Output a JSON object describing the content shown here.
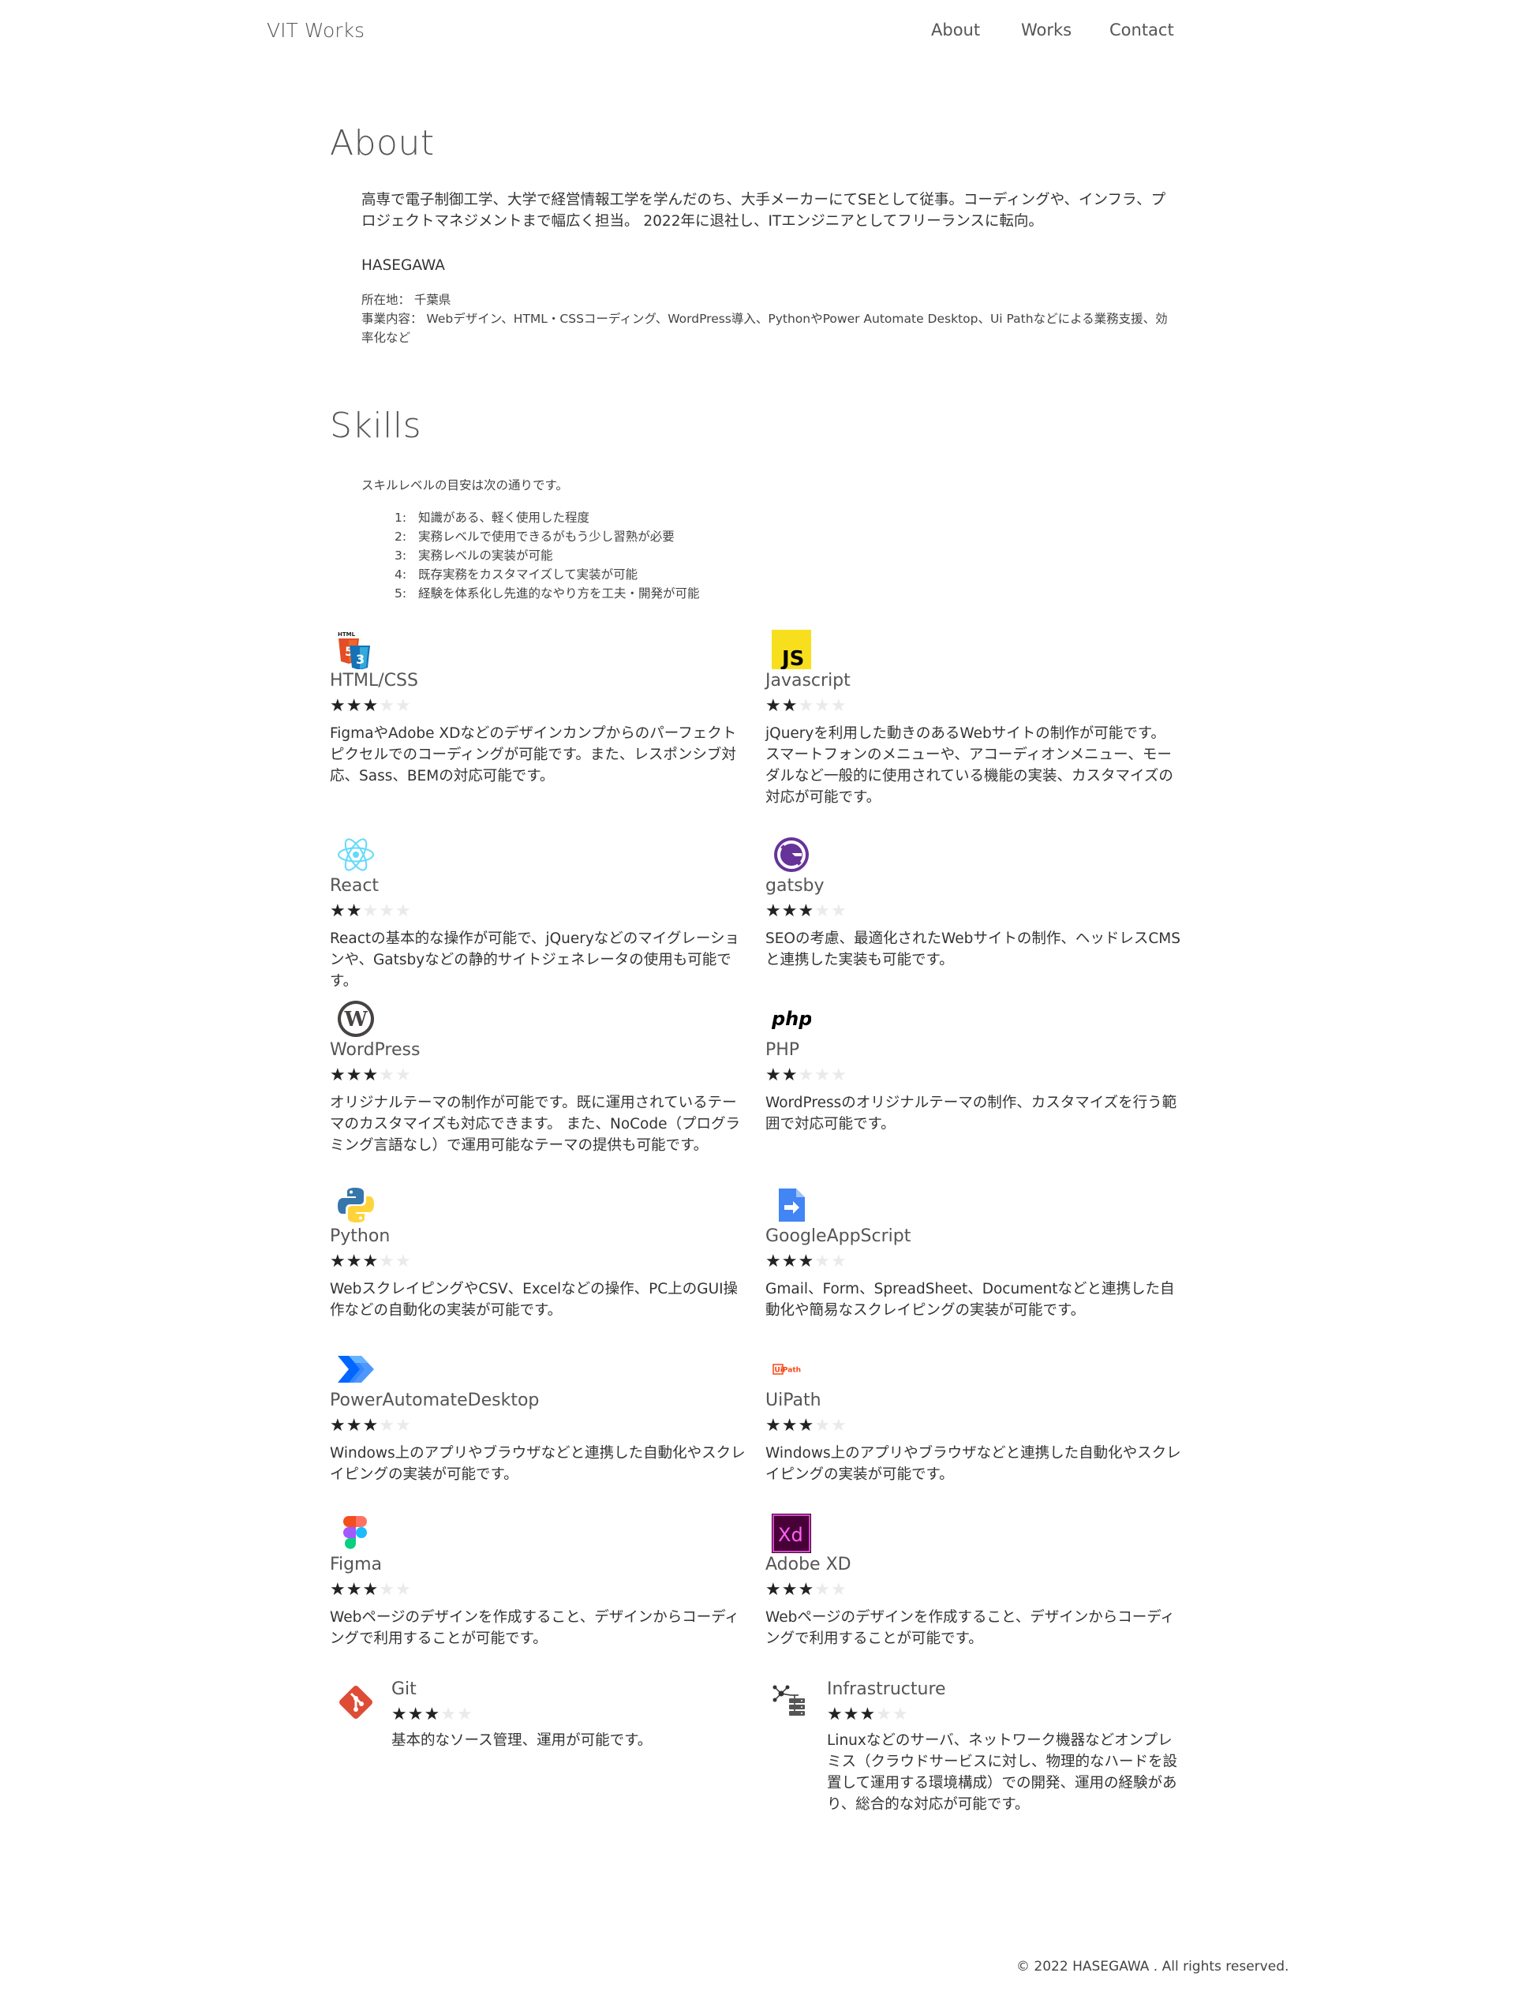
{
  "header": {
    "brand": "VIT Works",
    "nav": [
      {
        "label": "About"
      },
      {
        "label": "Works"
      },
      {
        "label": "Contact"
      }
    ]
  },
  "about": {
    "title": "About",
    "body": "高専で電子制御工学、大学で経営情報工学を学んだのち、大手メーカーにてSEとして従事。コーディングや、インフラ、プロジェクトマネジメントまで幅広く担当。 2022年に退社し、ITエンジニアとしてフリーランスに転向。",
    "name": "HASEGAWA",
    "location": "所在地： 千葉県",
    "business": "事業内容： Webデザイン、HTML・CSSコーディング、WordPress導入、PythonやPower Automate Desktop、Ui Pathなどによる業務支援、効率化など"
  },
  "skills": {
    "title": "Skills",
    "intro": "スキルレベルの目安は次の通りです。",
    "levels": [
      {
        "num": "1:",
        "text": "知識がある、軽く使用した程度"
      },
      {
        "num": "2:",
        "text": "実務レベルで使用できるがもう少し習熟が必要"
      },
      {
        "num": "3:",
        "text": "実務レベルの実装が可能"
      },
      {
        "num": "4:",
        "text": "既存実務をカスタマイズして実装が可能"
      },
      {
        "num": "5:",
        "text": "経験を体系化し先進的なやり方を工夫・開発が可能"
      }
    ],
    "max_stars": 5,
    "items": [
      {
        "name": "HTML/CSS",
        "icon": "html-css-icon",
        "rating": 3,
        "desc": "FigmaやAdobe XDなどのデザインカンプからのパーフェクトピクセルでのコーディングが可能です。また、レスポンシブ対応、Sass、BEMの対応可能です。"
      },
      {
        "name": "Javascript",
        "icon": "javascript-icon",
        "rating": 2,
        "desc": "jQueryを利用した動きのあるWebサイトの制作が可能です。 スマートフォンのメニューや、アコーディオンメニュー、モーダルなど一般的に使用されている機能の実装、カスタマイズの対応が可能です。"
      },
      {
        "name": "React",
        "icon": "react-icon",
        "rating": 2,
        "desc": "Reactの基本的な操作が可能で、jQueryなどのマイグレーションや、Gatsbyなどの静的サイトジェネレータの使用も可能です。"
      },
      {
        "name": "gatsby",
        "icon": "gatsby-icon",
        "rating": 3,
        "desc": "SEOの考慮、最適化されたWebサイトの制作、ヘッドレスCMSと連携した実装も可能です。"
      },
      {
        "name": "WordPress",
        "icon": "wordpress-icon",
        "rating": 3,
        "desc": "オリジナルテーマの制作が可能です。既に運用されているテーマのカスタマイズも対応できます。 また、NoCode（プログラミング言語なし）で運用可能なテーマの提供も可能です。"
      },
      {
        "name": "PHP",
        "icon": "php-icon",
        "rating": 2,
        "desc": "WordPressのオリジナルテーマの制作、カスタマイズを行う範囲で対応可能です。"
      },
      {
        "name": "Python",
        "icon": "python-icon",
        "rating": 3,
        "desc": "WebスクレイピングやCSV、Excelなどの操作、PC上のGUI操作などの自動化の実装が可能です。"
      },
      {
        "name": "GoogleAppScript",
        "icon": "google-apps-script-icon",
        "rating": 3,
        "desc": "Gmail、Form、SpreadSheet、Documentなどと連携した自動化や簡易なスクレイピングの実装が可能です。"
      },
      {
        "name": "PowerAutomateDesktop",
        "icon": "power-automate-icon",
        "rating": 3,
        "desc": "Windows上のアプリやブラウザなどと連携した自動化やスクレイピングの実装が可能です。"
      },
      {
        "name": "UiPath",
        "icon": "uipath-icon",
        "icon_text": "UiPath",
        "rating": 3,
        "desc": "Windows上のアプリやブラウザなどと連携した自動化やスクレイピングの実装が可能です。"
      },
      {
        "name": "Figma",
        "icon": "figma-icon",
        "rating": 3,
        "desc": "Webページのデザインを作成すること、デザインからコーディングで利用することが可能です。"
      },
      {
        "name": "Adobe XD",
        "icon": "adobe-xd-icon",
        "icon_text": "Xd",
        "rating": 3,
        "desc": "Webページのデザインを作成すること、デザインからコーディングで利用することが可能です。"
      },
      {
        "name": "Git",
        "icon": "git-icon",
        "rating": 3,
        "desc": "基本的なソース管理、運用が可能です。"
      },
      {
        "name": "Infrastructure",
        "icon": "infrastructure-icon",
        "rating": 3,
        "desc": "Linuxなどのサーバ、ネットワーク機器などオンプレミス（クラウドサービスに対し、物理的なハードを設置して運用する環境構成）での開発、運用の経験があり、総合的な対応が可能です。"
      }
    ]
  },
  "footer": {
    "copyright": "© 2022 HASEGAWA . All rights reserved."
  },
  "colors": {
    "star_on": "#222222",
    "star_off": "#eaeaea",
    "javascript": "#f7df1e",
    "adobe_xd": "#470137",
    "adobe_xd_accent": "#ff61f6",
    "react": "#61dafb",
    "gatsby": "#663399",
    "git": "#de4c36",
    "uipath": "#fa4616"
  }
}
